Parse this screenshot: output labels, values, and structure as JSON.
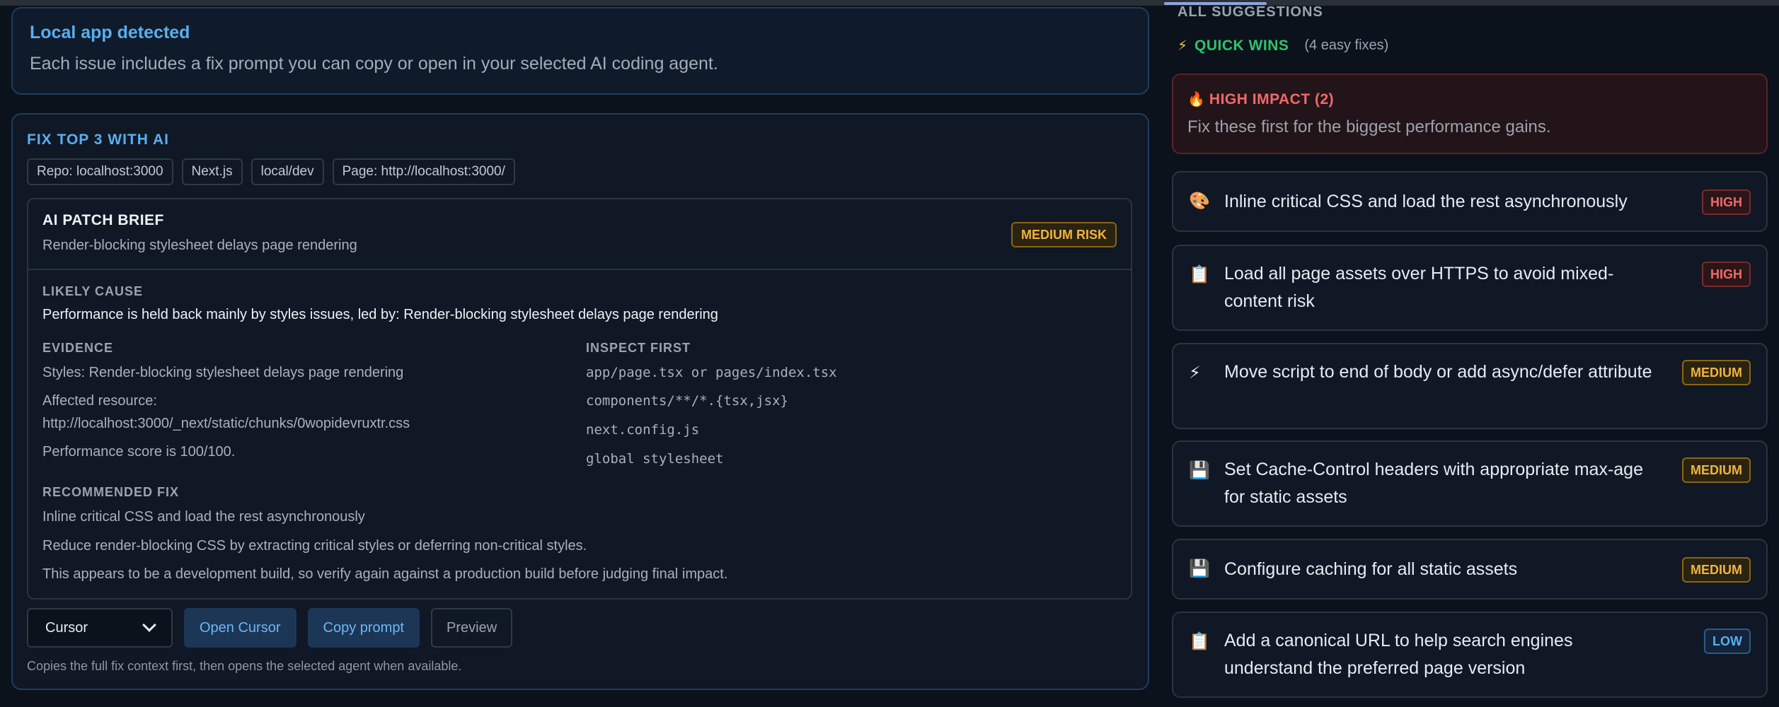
{
  "banner": {
    "title": "Local app detected",
    "description": "Each issue includes a fix prompt you can copy or open in your selected AI coding agent."
  },
  "fix": {
    "title": "FIX TOP 3 WITH AI",
    "chips": [
      "Repo: localhost:3000",
      "Next.js",
      "local/dev",
      "Page: http://localhost:3000/"
    ],
    "brief": {
      "title": "AI PATCH BRIEF",
      "subtitle": "Render-blocking stylesheet delays page rendering",
      "risk": "MEDIUM RISK",
      "likely_cause_label": "LIKELY CAUSE",
      "likely_cause": "Performance is held back mainly by styles issues, led by: Render-blocking stylesheet delays page rendering",
      "evidence_label": "EVIDENCE",
      "evidence": [
        "Styles: Render-blocking stylesheet delays page rendering",
        "Affected resource:",
        "http://localhost:3000/_next/static/chunks/0wopidevruxtr.css",
        "Performance score is 100/100."
      ],
      "inspect_label": "INSPECT FIRST",
      "inspect": [
        "app/page.tsx or pages/index.tsx",
        "components/**/*.{tsx,jsx}",
        "next.config.js",
        "global stylesheet"
      ],
      "recommended_label": "RECOMMENDED FIX",
      "recommended": [
        "Inline critical CSS and load the rest asynchronously",
        "Reduce render-blocking CSS by extracting critical styles or deferring non-critical styles.",
        "This appears to be a development build, so verify again against a production build before judging final impact."
      ]
    },
    "agent_select": "Cursor",
    "open_button": "Open Cursor",
    "copy_button": "Copy prompt",
    "preview_button": "Preview",
    "note": "Copies the full fix context first, then opens the selected agent when available."
  },
  "sidebar": {
    "all_suggestions": "ALL SUGGESTIONS",
    "quick_wins_icon": "⚡",
    "quick_wins": "QUICK WINS",
    "quick_wins_count": "(4 easy fixes)",
    "high_impact_icon": "🔥",
    "high_impact": "HIGH IMPACT (2)",
    "high_impact_desc": "Fix these first for the biggest performance gains.",
    "items": [
      {
        "icon": "🎨",
        "text": "Inline critical CSS and load the rest asynchronously",
        "badge": "HIGH"
      },
      {
        "icon": "📋",
        "text": "Load all page assets over HTTPS to avoid mixed-content risk",
        "badge": "HIGH"
      },
      {
        "icon": "⚡",
        "text": "Move script to end of body or add async/defer attribute",
        "badge": "MEDIUM"
      },
      {
        "icon": "💾",
        "text": "Set Cache-Control headers with appropriate max-age for static assets",
        "badge": "MEDIUM"
      },
      {
        "icon": "💾",
        "text": "Configure caching for all static assets",
        "badge": "MEDIUM"
      },
      {
        "icon": "📋",
        "text": "Add a canonical URL to help search engines understand the preferred page version",
        "badge": "LOW"
      }
    ]
  },
  "colors": {
    "accent": "#58aef0",
    "quick_wins": "#2fc36b",
    "high": "#f06a6a",
    "medium": "#f0b43c",
    "low": "#58aef0"
  }
}
